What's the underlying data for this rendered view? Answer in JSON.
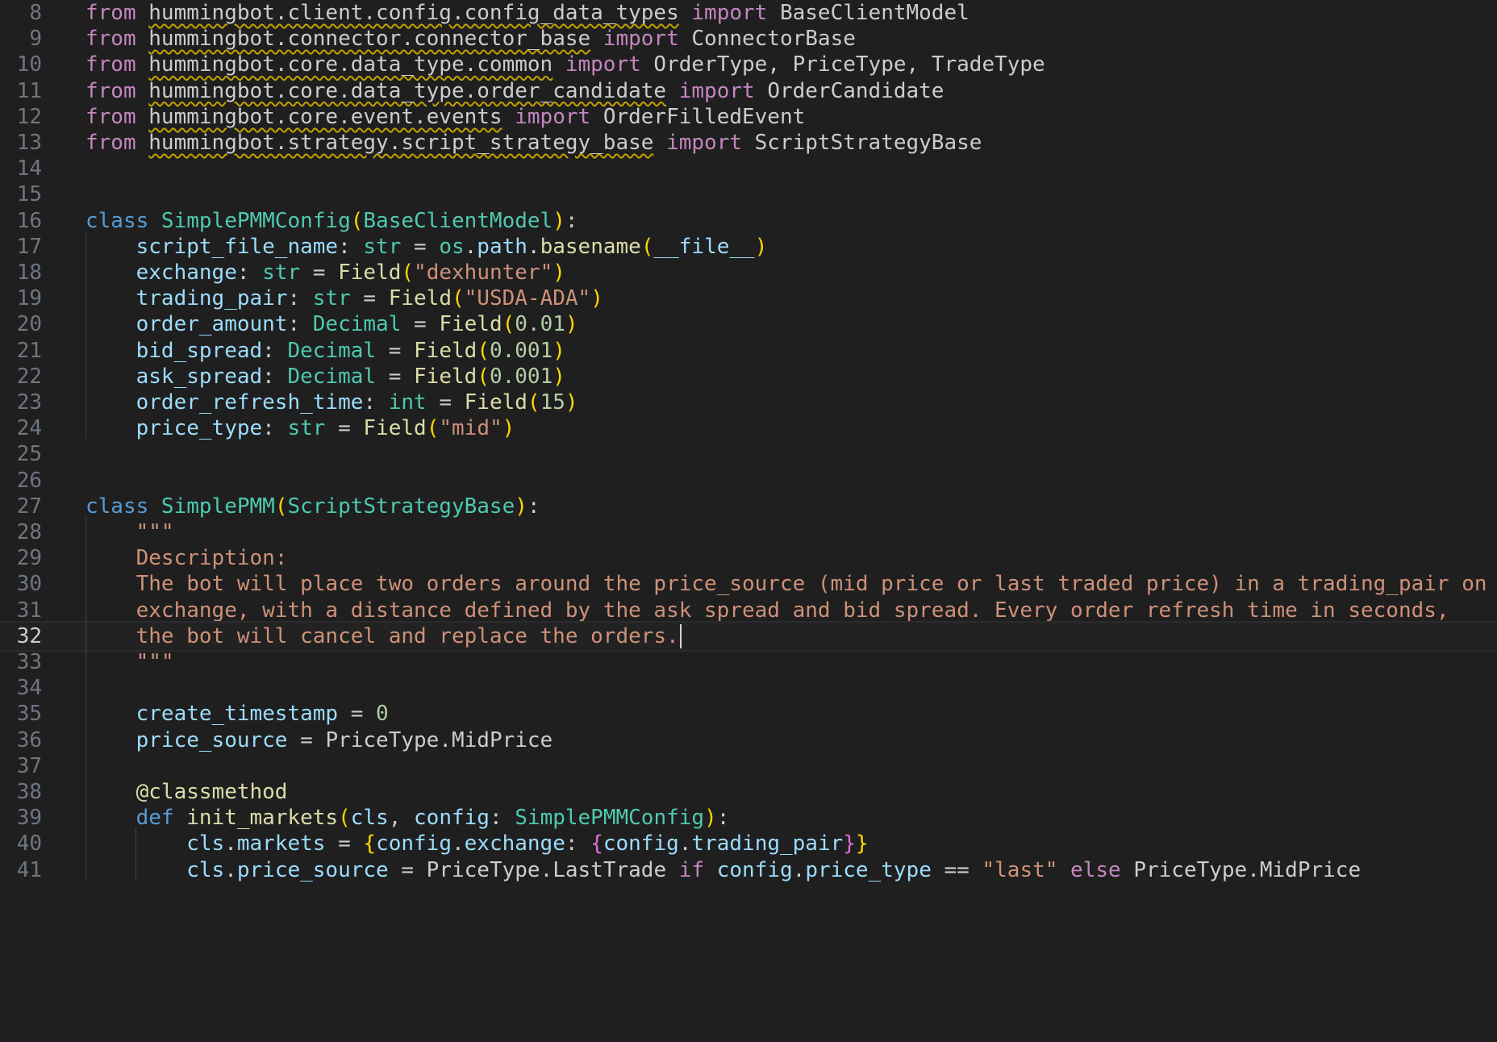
{
  "editor": {
    "language": "python",
    "current_line": 32,
    "colors": {
      "background": "#1f1f1f",
      "keyword_import": "#c586c0",
      "keyword": "#569cd6",
      "class_name": "#4ec9b0",
      "function": "#dcdcaa",
      "variable": "#9cdcfe",
      "string": "#ce9178",
      "number": "#b5cea8",
      "paren": "#ffd700",
      "brace_inner": "#da70d6",
      "text": "#cccccc",
      "line_number": "#6e7681",
      "squiggle": "#c2a200"
    },
    "lines": [
      {
        "n": "8",
        "t": [
          [
            "from ",
            "kw"
          ],
          [
            "hummingbot.client.config.config_data_types",
            "sq"
          ],
          [
            " import ",
            "kw"
          ],
          [
            "BaseClientModel",
            "cls"
          ]
        ]
      },
      {
        "n": "9",
        "t": [
          [
            "from ",
            "kw"
          ],
          [
            "hummingbot.connector.connector_base",
            "sq"
          ],
          [
            " import ",
            "kw"
          ],
          [
            "ConnectorBase",
            "cls"
          ]
        ]
      },
      {
        "n": "10",
        "t": [
          [
            "from ",
            "kw"
          ],
          [
            "hummingbot.core.data_type.common",
            "sq"
          ],
          [
            " import ",
            "kw"
          ],
          [
            "OrderType",
            "cls"
          ],
          [
            ", ",
            "p"
          ],
          [
            "PriceType",
            "cls"
          ],
          [
            ", ",
            "p"
          ],
          [
            "TradeType",
            "cls"
          ]
        ]
      },
      {
        "n": "11",
        "t": [
          [
            "from ",
            "kw"
          ],
          [
            "hummingbot.core.data_type.order_candidate",
            "sq"
          ],
          [
            " import ",
            "kw"
          ],
          [
            "OrderCandidate",
            "cls"
          ]
        ]
      },
      {
        "n": "12",
        "t": [
          [
            "from ",
            "kw"
          ],
          [
            "hummingbot.core.event.events",
            "sq"
          ],
          [
            " import ",
            "kw"
          ],
          [
            "OrderFilledEvent",
            "cls"
          ]
        ]
      },
      {
        "n": "13",
        "t": [
          [
            "from ",
            "kw"
          ],
          [
            "hummingbot.strategy.script_strategy_base",
            "sq"
          ],
          [
            " import ",
            "kw"
          ],
          [
            "ScriptStrategyBase",
            "cls"
          ]
        ]
      },
      {
        "n": "14",
        "t": []
      },
      {
        "n": "15",
        "t": []
      },
      {
        "n": "16",
        "t": [
          [
            "class ",
            "def"
          ],
          [
            "SimplePMMConfig",
            "ty"
          ],
          [
            "(",
            "par"
          ],
          [
            "BaseClientModel",
            "ty"
          ],
          [
            ")",
            "par"
          ],
          [
            ":",
            "p"
          ]
        ]
      },
      {
        "n": "17",
        "t": [
          [
            "    ",
            "p"
          ],
          [
            "script_file_name",
            "var"
          ],
          [
            ": ",
            "p"
          ],
          [
            "str",
            "ty"
          ],
          [
            " = ",
            "p"
          ],
          [
            "os",
            "ty"
          ],
          [
            ".",
            "p"
          ],
          [
            "path",
            "var"
          ],
          [
            ".",
            "p"
          ],
          [
            "basename",
            "fn"
          ],
          [
            "(",
            "par"
          ],
          [
            "__file__",
            "var"
          ],
          [
            ")",
            "par"
          ]
        ]
      },
      {
        "n": "18",
        "t": [
          [
            "    ",
            "p"
          ],
          [
            "exchange",
            "var"
          ],
          [
            ": ",
            "p"
          ],
          [
            "str",
            "ty"
          ],
          [
            " = ",
            "p"
          ],
          [
            "Field",
            "fn"
          ],
          [
            "(",
            "par"
          ],
          [
            "\"dexhunter\"",
            "str"
          ],
          [
            ")",
            "par"
          ]
        ]
      },
      {
        "n": "19",
        "t": [
          [
            "    ",
            "p"
          ],
          [
            "trading_pair",
            "var"
          ],
          [
            ": ",
            "p"
          ],
          [
            "str",
            "ty"
          ],
          [
            " = ",
            "p"
          ],
          [
            "Field",
            "fn"
          ],
          [
            "(",
            "par"
          ],
          [
            "\"USDA-ADA\"",
            "str"
          ],
          [
            ")",
            "par"
          ]
        ]
      },
      {
        "n": "20",
        "t": [
          [
            "    ",
            "p"
          ],
          [
            "order_amount",
            "var"
          ],
          [
            ": ",
            "p"
          ],
          [
            "Decimal",
            "ty"
          ],
          [
            " = ",
            "p"
          ],
          [
            "Field",
            "fn"
          ],
          [
            "(",
            "par"
          ],
          [
            "0.01",
            "num"
          ],
          [
            ")",
            "par"
          ]
        ]
      },
      {
        "n": "21",
        "t": [
          [
            "    ",
            "p"
          ],
          [
            "bid_spread",
            "var"
          ],
          [
            ": ",
            "p"
          ],
          [
            "Decimal",
            "ty"
          ],
          [
            " = ",
            "p"
          ],
          [
            "Field",
            "fn"
          ],
          [
            "(",
            "par"
          ],
          [
            "0.001",
            "num"
          ],
          [
            ")",
            "par"
          ]
        ]
      },
      {
        "n": "22",
        "t": [
          [
            "    ",
            "p"
          ],
          [
            "ask_spread",
            "var"
          ],
          [
            ": ",
            "p"
          ],
          [
            "Decimal",
            "ty"
          ],
          [
            " = ",
            "p"
          ],
          [
            "Field",
            "fn"
          ],
          [
            "(",
            "par"
          ],
          [
            "0.001",
            "num"
          ],
          [
            ")",
            "par"
          ]
        ]
      },
      {
        "n": "23",
        "t": [
          [
            "    ",
            "p"
          ],
          [
            "order_refresh_time",
            "var"
          ],
          [
            ": ",
            "p"
          ],
          [
            "int",
            "ty"
          ],
          [
            " = ",
            "p"
          ],
          [
            "Field",
            "fn"
          ],
          [
            "(",
            "par"
          ],
          [
            "15",
            "num"
          ],
          [
            ")",
            "par"
          ]
        ]
      },
      {
        "n": "24",
        "t": [
          [
            "    ",
            "p"
          ],
          [
            "price_type",
            "var"
          ],
          [
            ": ",
            "p"
          ],
          [
            "str",
            "ty"
          ],
          [
            " = ",
            "p"
          ],
          [
            "Field",
            "fn"
          ],
          [
            "(",
            "par"
          ],
          [
            "\"mid\"",
            "str"
          ],
          [
            ")",
            "par"
          ]
        ]
      },
      {
        "n": "25",
        "t": []
      },
      {
        "n": "26",
        "t": []
      },
      {
        "n": "27",
        "t": [
          [
            "class ",
            "def"
          ],
          [
            "SimplePMM",
            "ty"
          ],
          [
            "(",
            "par"
          ],
          [
            "ScriptStrategyBase",
            "ty"
          ],
          [
            ")",
            "par"
          ],
          [
            ":",
            "p"
          ]
        ]
      },
      {
        "n": "28",
        "t": [
          [
            "    ",
            "p"
          ],
          [
            "\"\"\"",
            "str"
          ]
        ]
      },
      {
        "n": "29",
        "t": [
          [
            "    ",
            "p"
          ],
          [
            "Description:",
            "str"
          ]
        ]
      },
      {
        "n": "30",
        "t": [
          [
            "    ",
            "p"
          ],
          [
            "The bot will place two orders around the price_source (mid price or last traded price) in a trading_pair on",
            "str"
          ]
        ]
      },
      {
        "n": "31",
        "t": [
          [
            "    ",
            "p"
          ],
          [
            "exchange, with a distance defined by the ask_spread and bid_spread. Every order_refresh_time in seconds,",
            "str"
          ]
        ]
      },
      {
        "n": "32",
        "t": [
          [
            "    ",
            "p"
          ],
          [
            "the bot will cancel and replace the orders.",
            "str"
          ]
        ]
      },
      {
        "n": "33",
        "t": [
          [
            "    ",
            "p"
          ],
          [
            "\"\"\"",
            "str"
          ]
        ]
      },
      {
        "n": "34",
        "t": []
      },
      {
        "n": "35",
        "t": [
          [
            "    ",
            "p"
          ],
          [
            "create_timestamp",
            "var"
          ],
          [
            " = ",
            "p"
          ],
          [
            "0",
            "num"
          ]
        ]
      },
      {
        "n": "36",
        "t": [
          [
            "    ",
            "p"
          ],
          [
            "price_source",
            "var"
          ],
          [
            " = ",
            "p"
          ],
          [
            "PriceType",
            "cls"
          ],
          [
            ".",
            "p"
          ],
          [
            "MidPrice",
            "cls"
          ]
        ]
      },
      {
        "n": "37",
        "t": []
      },
      {
        "n": "38",
        "t": [
          [
            "    ",
            "p"
          ],
          [
            "@classmethod",
            "fn"
          ]
        ]
      },
      {
        "n": "39",
        "t": [
          [
            "    ",
            "p"
          ],
          [
            "def ",
            "def"
          ],
          [
            "init_markets",
            "fn"
          ],
          [
            "(",
            "par"
          ],
          [
            "cls",
            "var"
          ],
          [
            ", ",
            "p"
          ],
          [
            "config",
            "var"
          ],
          [
            ": ",
            "p"
          ],
          [
            "SimplePMMConfig",
            "ty"
          ],
          [
            ")",
            "par"
          ],
          [
            ":",
            "p"
          ]
        ]
      },
      {
        "n": "40",
        "t": [
          [
            "        ",
            "p"
          ],
          [
            "cls",
            "var"
          ],
          [
            ".",
            "p"
          ],
          [
            "markets",
            "var"
          ],
          [
            " = ",
            "p"
          ],
          [
            "{",
            "par"
          ],
          [
            "config",
            "var"
          ],
          [
            ".",
            "p"
          ],
          [
            "exchange",
            "var"
          ],
          [
            ": ",
            "p"
          ],
          [
            "{",
            "brace"
          ],
          [
            "config",
            "var"
          ],
          [
            ".",
            "p"
          ],
          [
            "trading_pair",
            "var"
          ],
          [
            "}",
            "brace"
          ],
          [
            "}",
            "par"
          ]
        ]
      },
      {
        "n": "41",
        "t": [
          [
            "        ",
            "p"
          ],
          [
            "cls",
            "var"
          ],
          [
            ".",
            "p"
          ],
          [
            "price_source",
            "var"
          ],
          [
            " = ",
            "p"
          ],
          [
            "PriceType",
            "cls"
          ],
          [
            ".",
            "p"
          ],
          [
            "LastTrade",
            "cls"
          ],
          [
            " if ",
            "kw"
          ],
          [
            "config",
            "var"
          ],
          [
            ".",
            "p"
          ],
          [
            "price_type",
            "var"
          ],
          [
            " == ",
            "p"
          ],
          [
            "\"last\"",
            "str"
          ],
          [
            " else ",
            "kw"
          ],
          [
            "PriceType",
            "cls"
          ],
          [
            ".",
            "p"
          ],
          [
            "MidPrice",
            "cls"
          ]
        ]
      }
    ]
  }
}
